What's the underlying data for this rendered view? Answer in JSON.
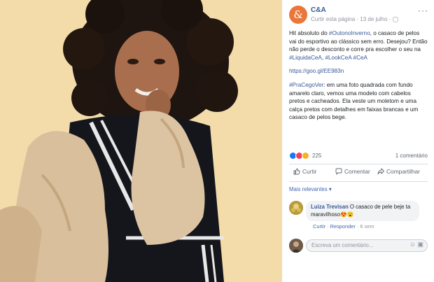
{
  "post": {
    "page_logo": "&",
    "page_name": "C&A",
    "meta": "Curtir esta página · 13 de julho · ",
    "globe_icon": "globe-icon",
    "more": "···",
    "p1a": "Hit absoluto do ",
    "tag1": "#OutonoInverno",
    "p1b": ", o casaco de pelos vai do esportivo ao clássico sem erro. Desejou? Então não perde o desconto e corre pra escolher o seu na ",
    "tag2": "#LiquidaCeA",
    "tag3": "#LookCeA",
    "tag4": "#CeA",
    "url": "https://goo.gl/EE983n",
    "tag5": "#PraCegoVer",
    "p3": ": em uma foto quadrada com fundo amarelo claro, vemos uma modelo com cabelos pretos e cacheados. Ela veste um moletom e uma calça pretos com detalhes em faixas brancas e um casaco de pelos bege."
  },
  "reactions": {
    "count": "225",
    "comments": "1 comentário",
    "colors": {
      "like": "#1877f2",
      "love": "#f33e58",
      "haha": "#f7b125"
    }
  },
  "actions": {
    "like": "Curtir",
    "comment": "Comentar",
    "share": "Compartilhar"
  },
  "relevant": "Mais relevantes ▾",
  "comment": {
    "author": "Luiza Trevisan",
    "text": " O casaco de pele beje ta maravilhoso😍😮",
    "like": "Curtir",
    "reply": "Responder",
    "time": "6 sem"
  },
  "write": {
    "placeholder": "Escreva um comentário..."
  }
}
